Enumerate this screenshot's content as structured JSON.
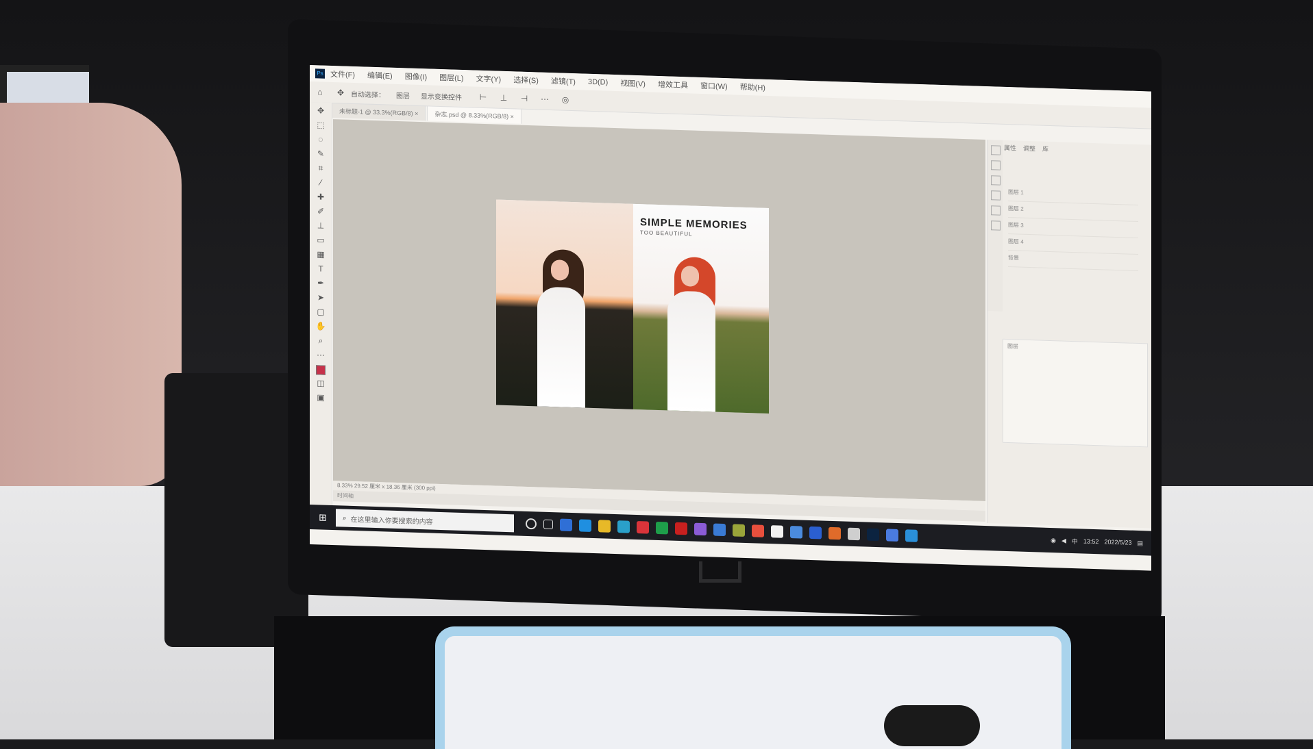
{
  "app": {
    "menus": [
      "文件(F)",
      "编辑(E)",
      "图像(I)",
      "图层(L)",
      "文字(Y)",
      "选择(S)",
      "滤镜(T)",
      "3D(D)",
      "视图(V)",
      "增效工具",
      "窗口(W)",
      "帮助(H)"
    ],
    "option_bar": {
      "auto_select": "自动选择：",
      "target": "图层",
      "show_transform": "显示变换控件"
    },
    "tabs": [
      {
        "label": "未标题-1 @ 33.3%(RGB/8) ×",
        "active": false
      },
      {
        "label": "杂志.psd @ 8.33%(RGB/8) ×",
        "active": true
      }
    ],
    "status_text": "8.33%   29.52 厘米 x 18.36 厘米 (300 ppi)",
    "timeline_label": "时间轴"
  },
  "document": {
    "headline": "SIMPLE MEMORIES",
    "subhead": "TOO BEAUTIFUL"
  },
  "panels": {
    "tabs": [
      "属性",
      "调整",
      "库"
    ],
    "layers_label": "图层",
    "layer_rows": [
      "图层 1",
      "图层 2",
      "图层 3",
      "图层 4",
      "背景"
    ]
  },
  "taskbar": {
    "search_placeholder": "在这里输入你要搜索的内容",
    "icons": [
      "#2f6fd6",
      "#1f8fe0",
      "#e7b928",
      "#2aa0c9",
      "#d9343a",
      "#1e9e4a",
      "#c8201f",
      "#8b5cd6",
      "#3a7bd5",
      "#9aa53a",
      "#e84f3d",
      "#f2f2f2",
      "#4b8bdd",
      "#2b5fd0",
      "#e06b2a",
      "#cfcfcf",
      "#0b2340",
      "#4a7be0",
      "#2a8fd8"
    ],
    "time": "13:52",
    "date": "2022/5/23"
  },
  "colors": {
    "foreground_color": "#c6324a",
    "taskbar_bg": "#1c1d22",
    "canvas_bg": "#c8c4bc"
  }
}
